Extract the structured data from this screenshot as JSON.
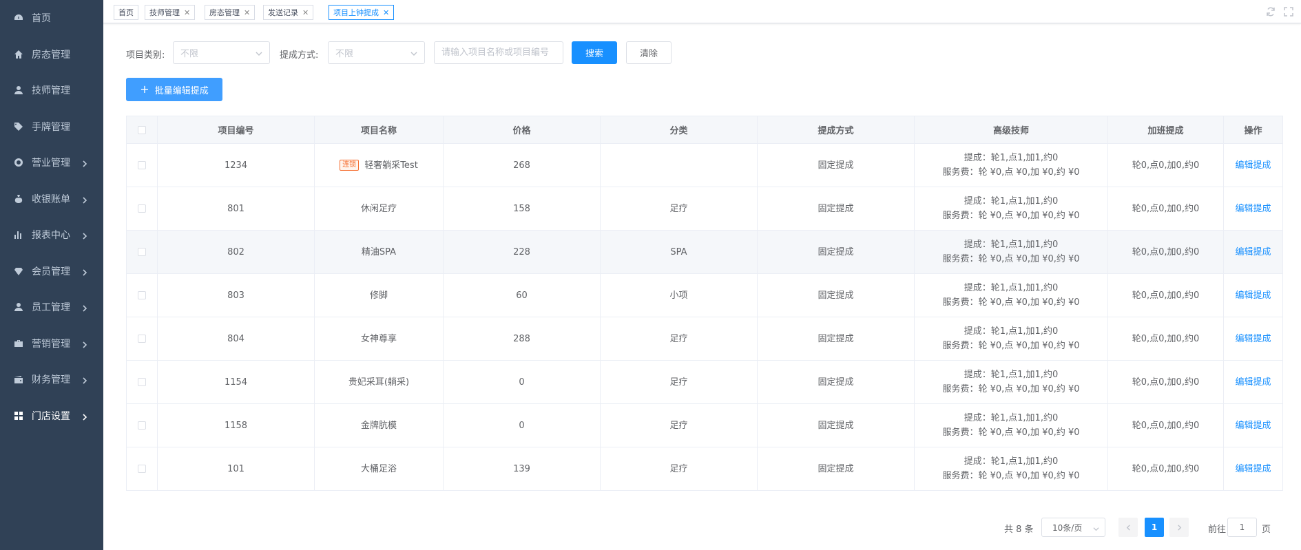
{
  "sidebar": {
    "items": [
      {
        "label": "首页",
        "icon": "dashboard-icon",
        "arrow": false
      },
      {
        "label": "房态管理",
        "icon": "home-icon",
        "arrow": false
      },
      {
        "label": "技师管理",
        "icon": "user-icon",
        "arrow": false
      },
      {
        "label": "手牌管理",
        "icon": "tag-icon",
        "arrow": false
      },
      {
        "label": "营业管理",
        "icon": "crosshair-icon",
        "arrow": true
      },
      {
        "label": "收银账单",
        "icon": "money-bag-icon",
        "arrow": true
      },
      {
        "label": "报表中心",
        "icon": "bar-chart-icon",
        "arrow": true
      },
      {
        "label": "会员管理",
        "icon": "diamond-icon",
        "arrow": true
      },
      {
        "label": "员工管理",
        "icon": "person-icon",
        "arrow": true
      },
      {
        "label": "营销管理",
        "icon": "briefcase-icon",
        "arrow": true
      },
      {
        "label": "财务管理",
        "icon": "wallet-icon",
        "arrow": true
      },
      {
        "label": "门店设置",
        "icon": "grid-icon",
        "arrow": true,
        "active": true
      }
    ]
  },
  "tabs": [
    {
      "label": "首页",
      "closable": false
    },
    {
      "label": "技师管理",
      "closable": true
    },
    {
      "label": "房态管理",
      "closable": true
    },
    {
      "label": "发送记录",
      "closable": true
    },
    {
      "label": "项目上钟提成",
      "closable": true,
      "active": true
    }
  ],
  "filters": {
    "category_label": "项目类别:",
    "category_value": "不限",
    "method_label": "提成方式:",
    "method_value": "不限",
    "search_placeholder": "请输入项目名称或项目编号",
    "search_btn": "搜索",
    "clear_btn": "清除"
  },
  "batch_btn": "批量编辑提成",
  "table": {
    "headers": [
      "",
      "项目编号",
      "项目名称",
      "价格",
      "分类",
      "提成方式",
      "高级技师",
      "加班提成",
      "操作"
    ],
    "rows": [
      {
        "id": "1234",
        "tag": "连锁",
        "name": "轻奢躺采Test",
        "price": "268",
        "category": "",
        "method": "固定提成",
        "senior_line1": "提成：轮1,点1,加1,约0",
        "senior_line2": "服务费：轮 ¥0,点 ¥0,加 ¥0,约 ¥0",
        "overtime": "轮0,点0,加0,约0",
        "action": "编辑提成"
      },
      {
        "id": "801",
        "tag": "",
        "name": "休闲足疗",
        "price": "158",
        "category": "足疗",
        "method": "固定提成",
        "senior_line1": "提成：轮1,点1,加1,约0",
        "senior_line2": "服务费：轮 ¥0,点 ¥0,加 ¥0,约 ¥0",
        "overtime": "轮0,点0,加0,约0",
        "action": "编辑提成"
      },
      {
        "id": "802",
        "tag": "",
        "name": "精油SPA",
        "price": "228",
        "category": "SPA",
        "method": "固定提成",
        "senior_line1": "提成：轮1,点1,加1,约0",
        "senior_line2": "服务费：轮 ¥0,点 ¥0,加 ¥0,约 ¥0",
        "overtime": "轮0,点0,加0,约0",
        "action": "编辑提成",
        "highlight": true
      },
      {
        "id": "803",
        "tag": "",
        "name": "修脚",
        "price": "60",
        "category": "小项",
        "method": "固定提成",
        "senior_line1": "提成：轮1,点1,加1,约0",
        "senior_line2": "服务费：轮 ¥0,点 ¥0,加 ¥0,约 ¥0",
        "overtime": "轮0,点0,加0,约0",
        "action": "编辑提成"
      },
      {
        "id": "804",
        "tag": "",
        "name": "女神尊享",
        "price": "288",
        "category": "足疗",
        "method": "固定提成",
        "senior_line1": "提成：轮1,点1,加1,约0",
        "senior_line2": "服务费：轮 ¥0,点 ¥0,加 ¥0,约 ¥0",
        "overtime": "轮0,点0,加0,约0",
        "action": "编辑提成"
      },
      {
        "id": "1154",
        "tag": "",
        "name": "贵妃采耳(躺采)",
        "price": "0",
        "category": "足疗",
        "method": "固定提成",
        "senior_line1": "提成：轮1,点1,加1,约0",
        "senior_line2": "服务费：轮 ¥0,点 ¥0,加 ¥0,约 ¥0",
        "overtime": "轮0,点0,加0,约0",
        "action": "编辑提成"
      },
      {
        "id": "1158",
        "tag": "",
        "name": "金牌肮模",
        "price": "0",
        "category": "足疗",
        "method": "固定提成",
        "senior_line1": "提成：轮1,点1,加1,约0",
        "senior_line2": "服务费：轮 ¥0,点 ¥0,加 ¥0,约 ¥0",
        "overtime": "轮0,点0,加0,约0",
        "action": "编辑提成"
      },
      {
        "id": "101",
        "tag": "",
        "name": "大桶足浴",
        "price": "139",
        "category": "足疗",
        "method": "固定提成",
        "senior_line1": "提成：轮1,点1,加1,约0",
        "senior_line2": "服务费：轮 ¥0,点 ¥0,加 ¥0,约 ¥0",
        "overtime": "轮0,点0,加0,约0",
        "action": "编辑提成"
      }
    ]
  },
  "pagination": {
    "total": "共 8 条",
    "page_size": "10条/页",
    "current": "1",
    "goto_label": "前往",
    "goto_value": "1",
    "goto_unit": "页"
  },
  "colors": {
    "sidebar_bg": "#304156",
    "primary": "#1890ff",
    "tag_orange": "#f56c2d"
  }
}
